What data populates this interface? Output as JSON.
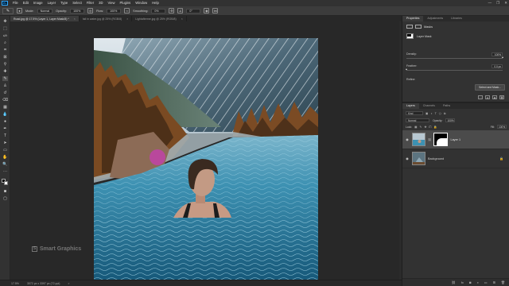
{
  "app": {
    "logo": "Ps"
  },
  "menu": [
    "File",
    "Edit",
    "Image",
    "Layer",
    "Type",
    "Select",
    "Filter",
    "3D",
    "View",
    "Plugins",
    "Window",
    "Help"
  ],
  "window_controls": {
    "minimize": "—",
    "restore": "❐",
    "close": "✕"
  },
  "options": {
    "mode_label": "Mode:",
    "mode_value": "Normal",
    "opacity_label": "Opacity:",
    "opacity_value": "100%",
    "flow_label": "Flow:",
    "flow_value": "100%",
    "smoothing_label": "Smoothing:",
    "smoothing_value": "0%",
    "angle_value": "0°"
  },
  "doc_tabs": [
    {
      "label": "Road.jpg @ 17.5% (Layer 1, Layer Mask/8) *",
      "active": true
    },
    {
      "label": "fall in water.jpg @ 25% (RGB/8)",
      "active": false
    },
    {
      "label": "Lightafterme.jpg @ 25% (RGB/8)",
      "active": false
    }
  ],
  "tab_close": "×",
  "statusbar": {
    "zoom": "17.5%",
    "doc_size": "3072 px x 3397 px (72 ppi)",
    "arrow": ">"
  },
  "watermark": {
    "badge": "S",
    "text": "Smart Graphics"
  },
  "panel_tabs": {
    "properties": "Properties",
    "adjustments": "Adjustments",
    "libraries": "Libraries"
  },
  "properties": {
    "title": "Masks",
    "mask_type": "Layer Mask",
    "density_label": "Density:",
    "density_value": "100%",
    "density_fraction": 1.0,
    "feather_label": "Feather:",
    "feather_value": "0.0 px",
    "feather_fraction": 0.0,
    "refine_label": "Refine:",
    "select_mask_button": "Select and Mask..."
  },
  "layers_panel_tabs": {
    "layers": "Layers",
    "channels": "Channels",
    "paths": "Paths"
  },
  "layers": {
    "kind_filter": "Kind",
    "blend_mode": "Normal",
    "opacity_label": "Opacity:",
    "opacity_value": "100%",
    "lock_label": "Lock:",
    "fill_label": "Fill:",
    "fill_value": "100%",
    "items": [
      {
        "name": "Layer 1",
        "visible": true,
        "selected": true,
        "has_mask": true
      },
      {
        "name": "Background",
        "visible": true,
        "selected": false,
        "locked": true
      }
    ]
  },
  "colors": {
    "accent": "#31a8ff",
    "panel_bg": "#323232",
    "canvas_bg": "#282828",
    "selected_layer": "#4b4b4b",
    "brush_cursor": "#c83cb4"
  }
}
